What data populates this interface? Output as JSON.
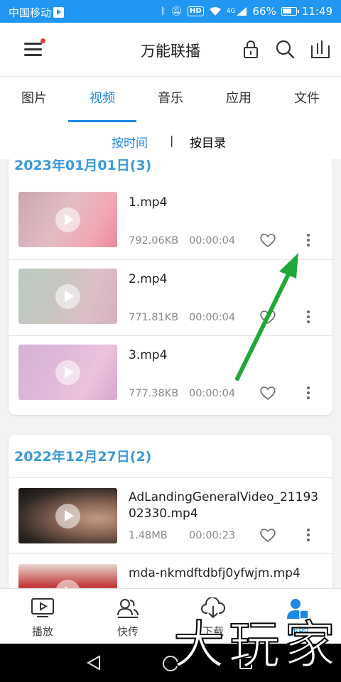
{
  "status_bar": {
    "carrier": "中国移动",
    "hd": "HD",
    "net": "4G",
    "battery": "66%",
    "time": "11:49"
  },
  "app_bar": {
    "title": "万能联播",
    "icons": [
      "menu-icon",
      "lock-icon",
      "search-icon",
      "sort-icon"
    ]
  },
  "tabs": [
    {
      "label": "图片",
      "active": false
    },
    {
      "label": "视频",
      "active": true
    },
    {
      "label": "音乐",
      "active": false
    },
    {
      "label": "应用",
      "active": false
    },
    {
      "label": "文件",
      "active": false
    }
  ],
  "sub_tabs": {
    "by_time": "按时间",
    "separator": "|",
    "by_folder": "按目录",
    "active": "by_time"
  },
  "groups": [
    {
      "header": "2023年01月01日(3)",
      "items": [
        {
          "name": "1.mp4",
          "size": "792.06KB",
          "duration": "00:00:04"
        },
        {
          "name": "2.mp4",
          "size": "771.81KB",
          "duration": "00:00:04"
        },
        {
          "name": "3.mp4",
          "size": "777.38KB",
          "duration": "00:00:04"
        }
      ]
    },
    {
      "header": "2022年12月27日(2)",
      "items": [
        {
          "name": "AdLandingGeneralVideo_2119302330.mp4",
          "size": "1.48MB",
          "duration": "00:00:23"
        },
        {
          "name": "mda-nkmdftdbfj0yfwjm.mp4",
          "size": "",
          "duration": ""
        }
      ]
    }
  ],
  "bottom_nav": [
    {
      "label": "播放",
      "icon": "play-screen-icon",
      "active": false
    },
    {
      "label": "快传",
      "icon": "users-icon",
      "active": false
    },
    {
      "label": "下载",
      "icon": "cloud-download-icon",
      "active": false
    },
    {
      "label": "我的",
      "icon": "profile-icon",
      "active": true
    }
  ],
  "watermark": "大玩家",
  "colors": {
    "accent": "#1e88e5",
    "status_bar": "#2196f3",
    "arrow": "#22a83a",
    "group_header": "#3a9ad9"
  }
}
